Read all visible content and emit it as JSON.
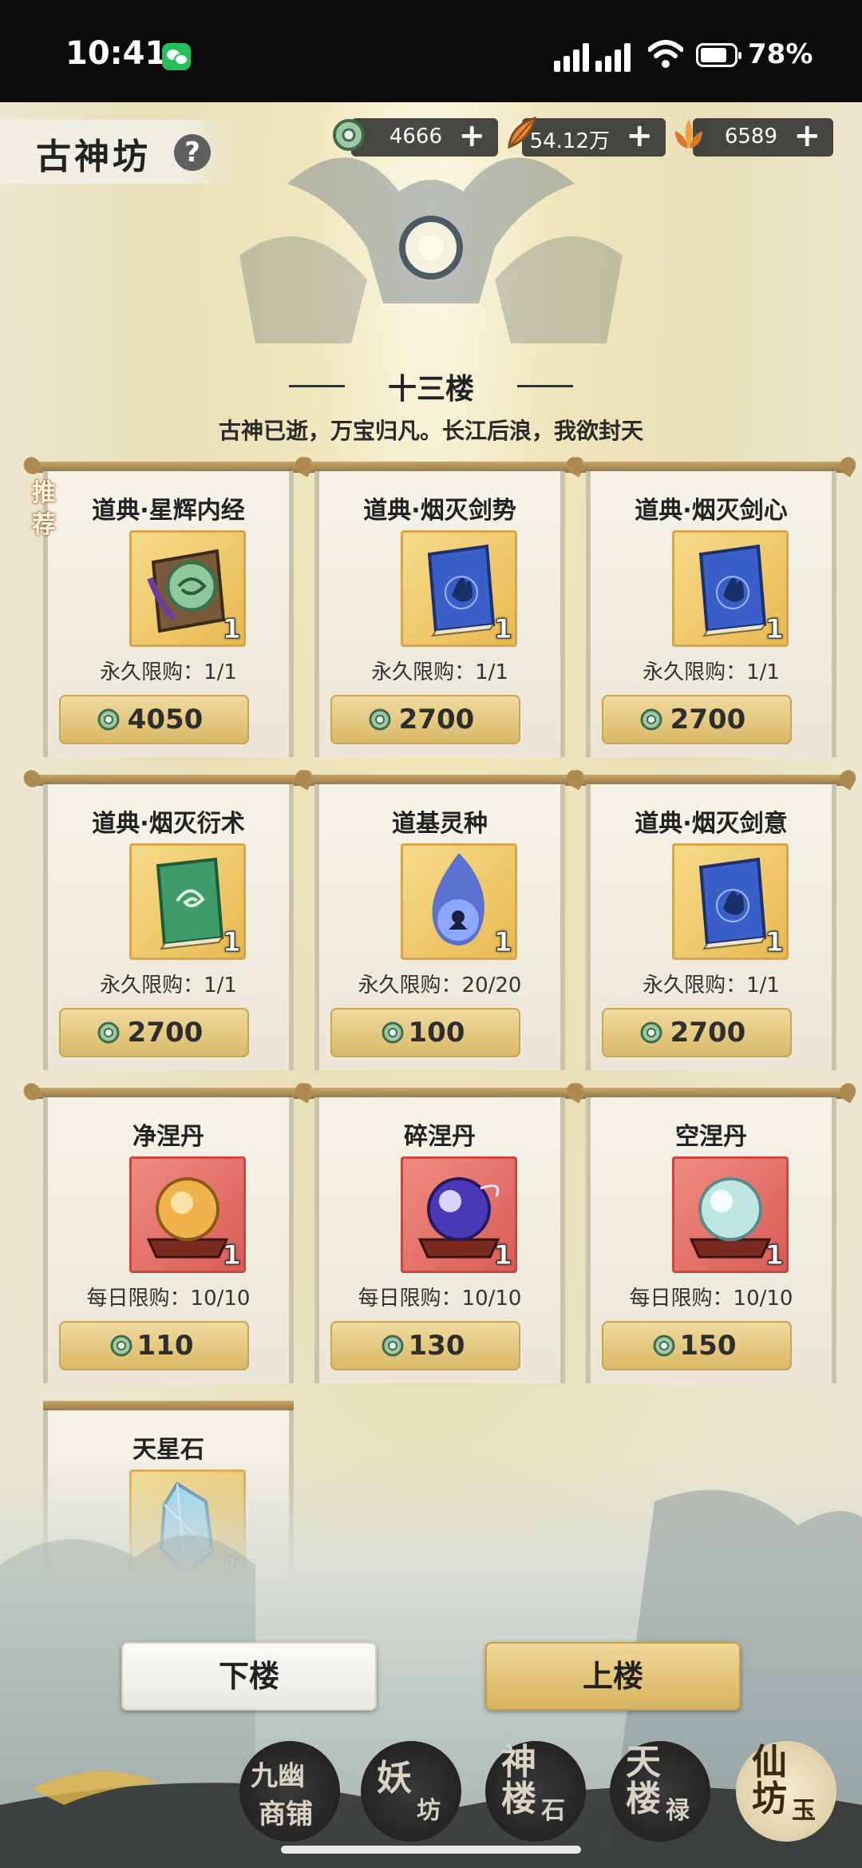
{
  "status_bar": {
    "time": "10:41",
    "battery": "78%"
  },
  "header": {
    "title": "古神坊",
    "help": "?",
    "currencies": [
      {
        "icon": "jade-coin-icon",
        "value": "4666"
      },
      {
        "icon": "feather-icon",
        "value": "54.12万"
      },
      {
        "icon": "flame-lotus-icon",
        "value": "6589"
      }
    ],
    "plus": "+"
  },
  "floor": {
    "name": "十三楼",
    "subtitle": "古神已逝，万宝归凡。长江后浪，我欲封天"
  },
  "recommend": "推荐",
  "items": [
    {
      "name": "道典·星辉内经",
      "icon": "green-scripture-book-icon",
      "qty": "1",
      "limit": "永久限购：1/1",
      "price": "4050"
    },
    {
      "name": "道典·烟灭剑势",
      "icon": "blue-scripture-book-icon",
      "qty": "1",
      "limit": "永久限购：1/1",
      "price": "2700"
    },
    {
      "name": "道典·烟灭剑心",
      "icon": "blue-scripture-book-icon",
      "qty": "1",
      "limit": "永久限购：1/1",
      "price": "2700"
    },
    {
      "name": "道典·烟灭衍术",
      "icon": "green-book-icon",
      "qty": "1",
      "limit": "永久限购：1/1",
      "price": "2700"
    },
    {
      "name": "道基灵种",
      "icon": "spirit-flame-icon",
      "qty": "1",
      "limit": "永久限购：20/20",
      "price": "100"
    },
    {
      "name": "道典·烟灭剑意",
      "icon": "blue-scripture-book-icon",
      "qty": "1",
      "limit": "永久限购：1/1",
      "price": "2700"
    },
    {
      "name": "净涅丹",
      "icon": "golden-pill-icon",
      "qty": "1",
      "limit": "每日限购：10/10",
      "price": "110"
    },
    {
      "name": "碎涅丹",
      "icon": "purple-pill-icon",
      "qty": "1",
      "limit": "每日限购：10/10",
      "price": "130"
    },
    {
      "name": "空涅丹",
      "icon": "cyan-pill-icon",
      "qty": "1",
      "limit": "每日限购：10/10",
      "price": "150"
    },
    {
      "name": "天星石",
      "icon": "crystal-stone-icon",
      "qty": "1"
    }
  ],
  "buttons": {
    "down": "下楼",
    "up": "上楼"
  },
  "bottom_nav": [
    {
      "label_big": "九幽",
      "label_small": "商铺"
    },
    {
      "label_big": "妖",
      "label_small": "坊"
    },
    {
      "label_big": "神楼",
      "label_small": "石"
    },
    {
      "label_big": "天楼",
      "label_small": "禄"
    },
    {
      "label_big": "仙坊",
      "label_small": "玉"
    }
  ]
}
